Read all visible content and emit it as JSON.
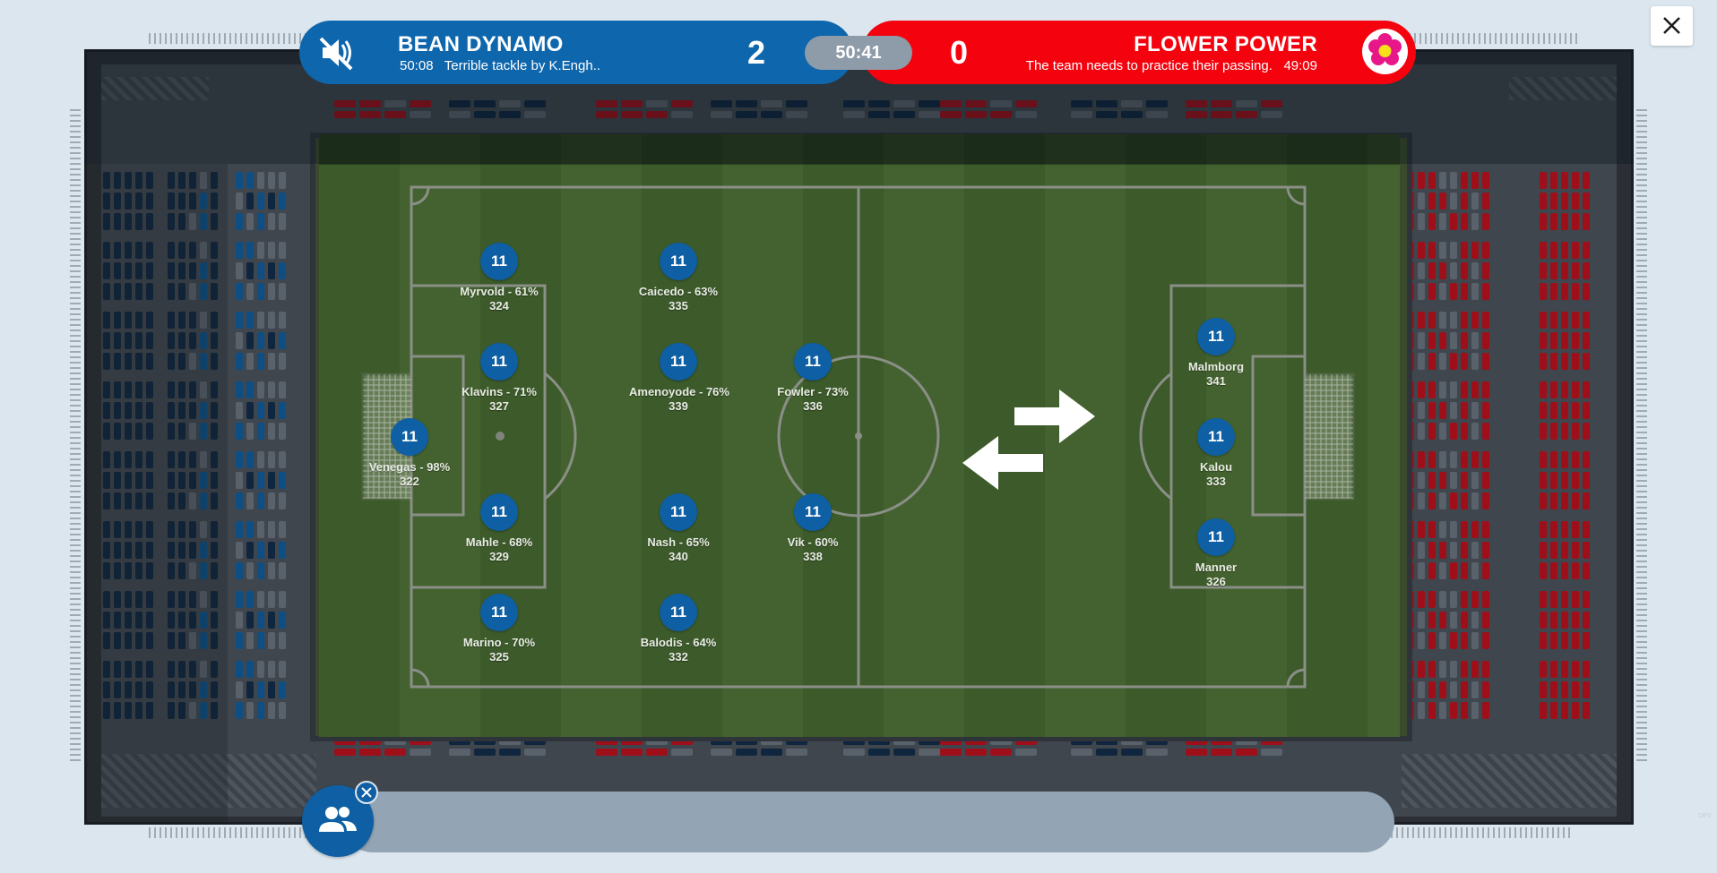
{
  "scoreboard": {
    "home": {
      "name": "BEAN DYNAMO",
      "score": "2",
      "event_time": "50:08",
      "event_text": "Terrible tackle by K.Engh.."
    },
    "away": {
      "name": "FLOWER POWER",
      "score": "0",
      "event_time": "49:09",
      "event_text": "The team needs to practice their passing."
    },
    "clock": "50:41"
  },
  "colors": {
    "home": "#0e66ad",
    "away": "#f4020e",
    "clock_bg": "#8e9ba8",
    "pitch": "#3c5a2a"
  },
  "icons": {
    "mute": "volume-off-icon",
    "close": "close-icon",
    "swap": "swap-arrows-icon",
    "team": "group-icon",
    "badge": "flower-icon"
  },
  "players_home": [
    {
      "number": "11",
      "name": "Myrvold - 61%",
      "value": "324"
    },
    {
      "number": "11",
      "name": "Caicedo - 63%",
      "value": "335"
    },
    {
      "number": "11",
      "name": "Klavins - 71%",
      "value": "327"
    },
    {
      "number": "11",
      "name": "Amenoyode - 76%",
      "value": "339"
    },
    {
      "number": "11",
      "name": "Fowler - 73%",
      "value": "336"
    },
    {
      "number": "11",
      "name": "Venegas - 98%",
      "value": "322"
    },
    {
      "number": "11",
      "name": "Mahle - 68%",
      "value": "329"
    },
    {
      "number": "11",
      "name": "Nash - 65%",
      "value": "340"
    },
    {
      "number": "11",
      "name": "Vik - 60%",
      "value": "338"
    },
    {
      "number": "11",
      "name": "Marino - 70%",
      "value": "325"
    },
    {
      "number": "11",
      "name": "Balodis - 64%",
      "value": "332"
    }
  ],
  "players_away": [
    {
      "number": "11",
      "name": "Malmborg",
      "value": "341"
    },
    {
      "number": "11",
      "name": "Kalou",
      "value": "333"
    },
    {
      "number": "11",
      "name": "Manner",
      "value": "326"
    }
  ],
  "watermark": "DEV"
}
